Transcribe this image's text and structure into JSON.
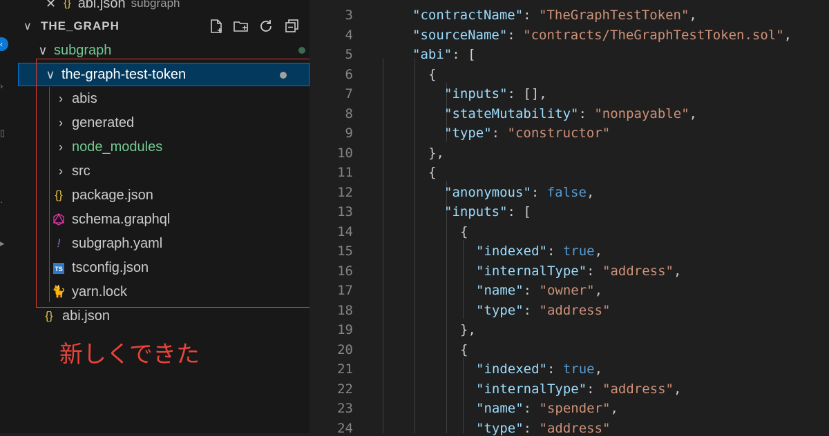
{
  "top_tab": {
    "icon": "{}",
    "filename": "abi.json",
    "folder": "subgraph"
  },
  "explorer": {
    "root_title": "THE_GRAPH",
    "items": [
      {
        "label": "subgraph",
        "type": "folder",
        "expanded": true
      },
      {
        "label": "the-graph-test-token",
        "type": "folder",
        "expanded": true,
        "selected": true
      },
      {
        "label": "abis",
        "type": "folder",
        "expanded": false
      },
      {
        "label": "generated",
        "type": "folder",
        "expanded": false
      },
      {
        "label": "node_modules",
        "type": "folder",
        "expanded": false
      },
      {
        "label": "src",
        "type": "folder",
        "expanded": false
      },
      {
        "label": "package.json",
        "icon": "{}"
      },
      {
        "label": "schema.graphql"
      },
      {
        "label": "subgraph.yaml",
        "icon": "!"
      },
      {
        "label": "tsconfig.json",
        "icon": "TS"
      },
      {
        "label": "yarn.lock"
      },
      {
        "label": "abi.json",
        "icon": "{}"
      }
    ]
  },
  "annotation": {
    "text": "新しくできた",
    "color": "#e8433a"
  },
  "editor": {
    "line_numbers": [
      "3",
      "4",
      "5",
      "6",
      "7",
      "8",
      "9",
      "10",
      "11",
      "12",
      "13",
      "14",
      "15",
      "16",
      "17",
      "18",
      "19",
      "20",
      "21",
      "22",
      "23",
      "24"
    ],
    "lines": {
      "l3": {
        "key": "\"contractName\"",
        "val": "\"TheGraphTestToken\""
      },
      "l4": {
        "key": "\"sourceName\"",
        "val": "\"contracts/TheGraphTestToken.sol\""
      },
      "l5": {
        "key": "\"abi\"",
        "tail": ": ["
      },
      "l6": "{",
      "l7": {
        "key": "\"inputs\"",
        "tail": ": [],"
      },
      "l8": {
        "key": "\"stateMutability\"",
        "val": "\"nonpayable\""
      },
      "l9": {
        "key": "\"type\"",
        "val": "\"constructor\""
      },
      "l10": "},",
      "l11": "{",
      "l12": {
        "key": "\"anonymous\"",
        "bool": "false"
      },
      "l13": {
        "key": "\"inputs\"",
        "tail": ": ["
      },
      "l14": "{",
      "l15": {
        "key": "\"indexed\"",
        "bool": "true"
      },
      "l16": {
        "key": "\"internalType\"",
        "val": "\"address\""
      },
      "l17": {
        "key": "\"name\"",
        "val": "\"owner\""
      },
      "l18": {
        "key": "\"type\"",
        "val": "\"address\""
      },
      "l19": "},",
      "l20": "{",
      "l21": {
        "key": "\"indexed\"",
        "bool": "true"
      },
      "l22": {
        "key": "\"internalType\"",
        "val": "\"address\""
      },
      "l23": {
        "key": "\"name\"",
        "val": "\"spender\""
      },
      "l24": {
        "key": "\"type\"",
        "val": "\"address\""
      }
    }
  },
  "colors": {
    "key": "#9cdcfe",
    "string": "#ce9178",
    "boolean": "#569cd6",
    "git_modified": "#73c991",
    "selection": "#04395e",
    "annotation_box": "#e03c31"
  }
}
